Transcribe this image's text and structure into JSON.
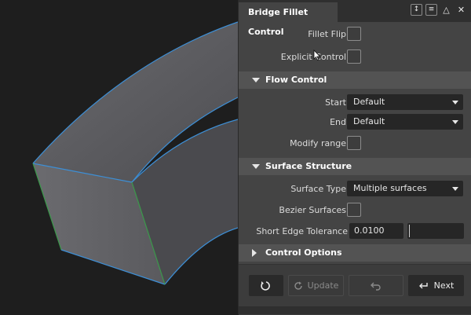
{
  "panel": {
    "title": "Bridge Fillet Control",
    "titlebar_icons": [
      "pin-icon",
      "menu-icon",
      "collapse-icon",
      "close-icon"
    ]
  },
  "top": {
    "fillet_flip": {
      "label": "Fillet Flip",
      "checked": false
    },
    "explicit_control": {
      "label": "Explicit Control",
      "checked": false
    }
  },
  "flow_control": {
    "title": "Flow Control",
    "expanded": true,
    "start": {
      "label": "Start",
      "value": "Default"
    },
    "end": {
      "label": "End",
      "value": "Default"
    },
    "modify_range": {
      "label": "Modify range",
      "checked": false
    }
  },
  "surface_structure": {
    "title": "Surface Structure",
    "expanded": true,
    "surface_type": {
      "label": "Surface Type",
      "value": "Multiple surfaces"
    },
    "bezier_surfaces": {
      "label": "Bezier Surfaces",
      "checked": false
    },
    "short_edge_tolerance": {
      "label": "Short Edge Tolerance",
      "value": "0.0100"
    }
  },
  "control_options": {
    "title": "Control Options",
    "expanded": false
  },
  "footer": {
    "reset_icon": "reset-icon",
    "update_label": "Update",
    "undo_icon": "undo-icon",
    "next_label": "Next"
  },
  "colors": {
    "panel_bg": "#444444",
    "section_bg": "#535353",
    "field_bg": "#262626",
    "edge_blue": "#3d8fd6",
    "edge_green": "#3a9a4a",
    "surface_gray": "#5e5e62"
  }
}
